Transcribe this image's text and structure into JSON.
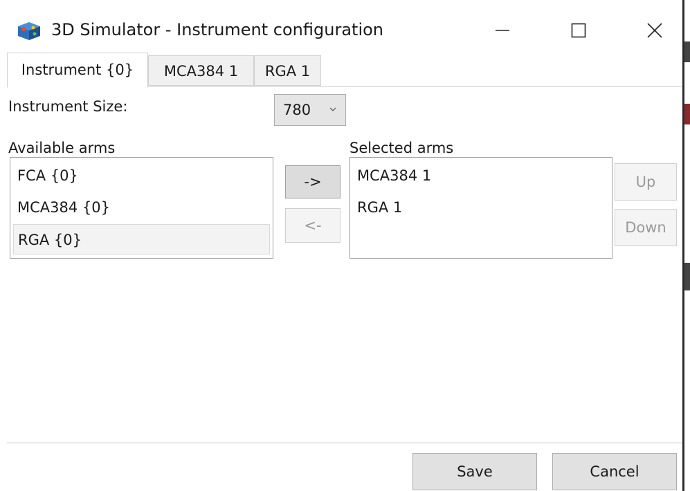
{
  "window": {
    "title": "3D Simulator - Instrument configuration",
    "icon": "app-simulator-icon",
    "controls": [
      "minimize-icon",
      "maximize-icon",
      "close-icon"
    ]
  },
  "tabs": [
    {
      "label": "Instrument {0}",
      "active": true
    },
    {
      "label": "MCA384 1",
      "active": false
    },
    {
      "label": "RGA 1",
      "active": false
    }
  ],
  "instrument": {
    "size_label": "Instrument Size:",
    "size_value": "780"
  },
  "available": {
    "label": "Available arms",
    "items": [
      "FCA {0}",
      "MCA384 {0}",
      "RGA {0}"
    ]
  },
  "transfer": {
    "add_label": "->",
    "remove_label": "<-"
  },
  "selected": {
    "label": "Selected arms",
    "items": [
      "MCA384 1",
      "RGA 1"
    ]
  },
  "order": {
    "up_label": "Up",
    "down_label": "Down"
  },
  "footer": {
    "save_label": "Save",
    "cancel_label": "Cancel"
  },
  "colors": {
    "tab_inactive": "#f0f0f0",
    "button": "#e1e1e1",
    "disabled_text": "#9a9a9a"
  }
}
